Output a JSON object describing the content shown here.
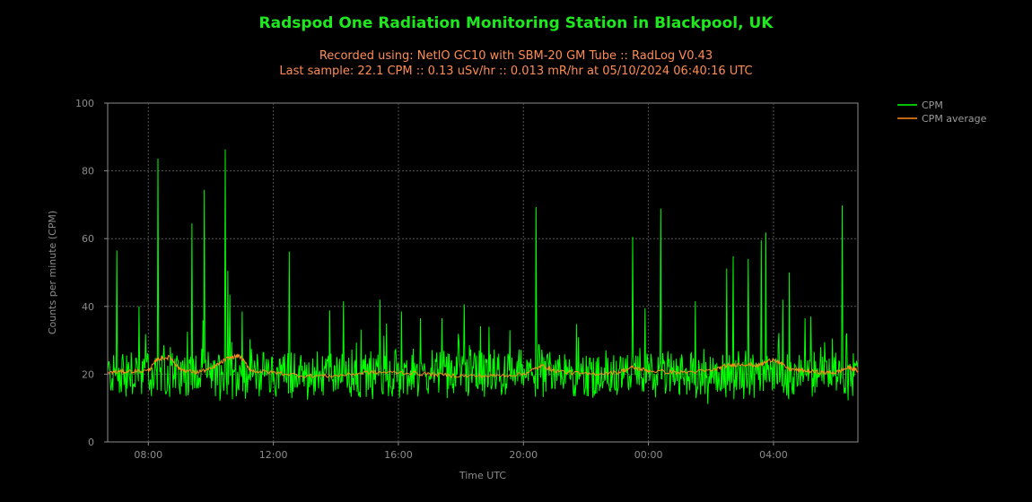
{
  "title": "Radspod One Radiation Monitoring Station in Blackpool, UK",
  "subtitle_line1": "Recorded using: NetIO GC10 with SBM-20 GM Tube :: RadLog V0.43",
  "subtitle_line2": "Last sample: 22.1 CPM :: 0.13 uSv/hr :: 0.013 mR/hr at 05/10/2024 06:40:16 UTC",
  "colors": {
    "title": "#1ee81e",
    "subtitle": "#ff8c55",
    "cpm": "#00ff00",
    "average": "#ff8c1a",
    "grid": "#555555",
    "axis": "#8c8c8c"
  },
  "chart_data": {
    "type": "line",
    "xlabel": "Time UTC",
    "ylabel": "Counts per minute (CPM)",
    "ylim": [
      0,
      100
    ],
    "yticks": [
      "0",
      "20",
      "40",
      "60",
      "80",
      "100"
    ],
    "xlim_hours": [
      6.7,
      30.7
    ],
    "xticks": [
      {
        "hour": 8,
        "label": "08:00"
      },
      {
        "hour": 12,
        "label": "12:00"
      },
      {
        "hour": 16,
        "label": "16:00"
      },
      {
        "hour": 20,
        "label": "20:00"
      },
      {
        "hour": 24,
        "label": "00:00"
      },
      {
        "hour": 28,
        "label": "04:00"
      }
    ],
    "grid": true,
    "legend_position": "top-right",
    "baseline_cpm": 20,
    "last_sample_cpm": 22.1,
    "series": [
      {
        "name": "CPM",
        "peaks_hour_cpm": [
          [
            7.0,
            56.5
          ],
          [
            7.7,
            40.0
          ],
          [
            8.3,
            83.6
          ],
          [
            8.7,
            28
          ],
          [
            9.25,
            32.5
          ],
          [
            9.4,
            64.5
          ],
          [
            9.8,
            74.4
          ],
          [
            10.45,
            86.3
          ],
          [
            10.55,
            50.5
          ],
          [
            10.6,
            43.5
          ],
          [
            11.0,
            38.5
          ],
          [
            12.5,
            56.2
          ],
          [
            13.8,
            38.8
          ],
          [
            14.25,
            41.5
          ],
          [
            15.4,
            42.0
          ],
          [
            16.1,
            38.5
          ],
          [
            16.7,
            36.5
          ],
          [
            17.4,
            36.5
          ],
          [
            18.1,
            40.6
          ],
          [
            18.9,
            34.0
          ],
          [
            20.4,
            69.3
          ],
          [
            21.7,
            34.8
          ],
          [
            23.5,
            60.5
          ],
          [
            23.9,
            39.5
          ],
          [
            24.4,
            68.9
          ],
          [
            25.5,
            41.5
          ],
          [
            26.5,
            51.2
          ],
          [
            26.7,
            54.8
          ],
          [
            27.2,
            54.0
          ],
          [
            27.6,
            59.5
          ],
          [
            27.75,
            61.8
          ],
          [
            28.3,
            42.0
          ],
          [
            28.5,
            50.0
          ],
          [
            29.0,
            36.5
          ],
          [
            29.2,
            37.0
          ],
          [
            30.2,
            69.8
          ],
          [
            30.35,
            32.0
          ]
        ]
      },
      {
        "name": "CPM average",
        "points_hour_cpm": [
          [
            6.7,
            20.5
          ],
          [
            7.3,
            20.8
          ],
          [
            8.0,
            21.0
          ],
          [
            8.3,
            24.5
          ],
          [
            8.7,
            25.0
          ],
          [
            9.0,
            21.5
          ],
          [
            9.5,
            20.5
          ],
          [
            10.0,
            21.5
          ],
          [
            10.5,
            24.5
          ],
          [
            10.9,
            25.5
          ],
          [
            11.3,
            21.0
          ],
          [
            12.0,
            20.5
          ],
          [
            13.0,
            19.5
          ],
          [
            14.0,
            19.5
          ],
          [
            15.0,
            20.5
          ],
          [
            16.0,
            20.5
          ],
          [
            17.0,
            20.0
          ],
          [
            18.0,
            19.5
          ],
          [
            19.0,
            19.5
          ],
          [
            20.0,
            20.0
          ],
          [
            20.6,
            22.5
          ],
          [
            21.0,
            21.0
          ],
          [
            22.0,
            20.0
          ],
          [
            23.0,
            20.5
          ],
          [
            23.5,
            22.0
          ],
          [
            24.0,
            21.0
          ],
          [
            25.0,
            20.5
          ],
          [
            26.0,
            21.0
          ],
          [
            26.5,
            22.5
          ],
          [
            27.0,
            23.0
          ],
          [
            27.5,
            22.5
          ],
          [
            28.0,
            24.5
          ],
          [
            28.5,
            21.5
          ],
          [
            29.0,
            21.0
          ],
          [
            29.5,
            20.5
          ],
          [
            30.0,
            20.5
          ],
          [
            30.4,
            22.0
          ],
          [
            30.7,
            21.0
          ]
        ]
      }
    ]
  }
}
